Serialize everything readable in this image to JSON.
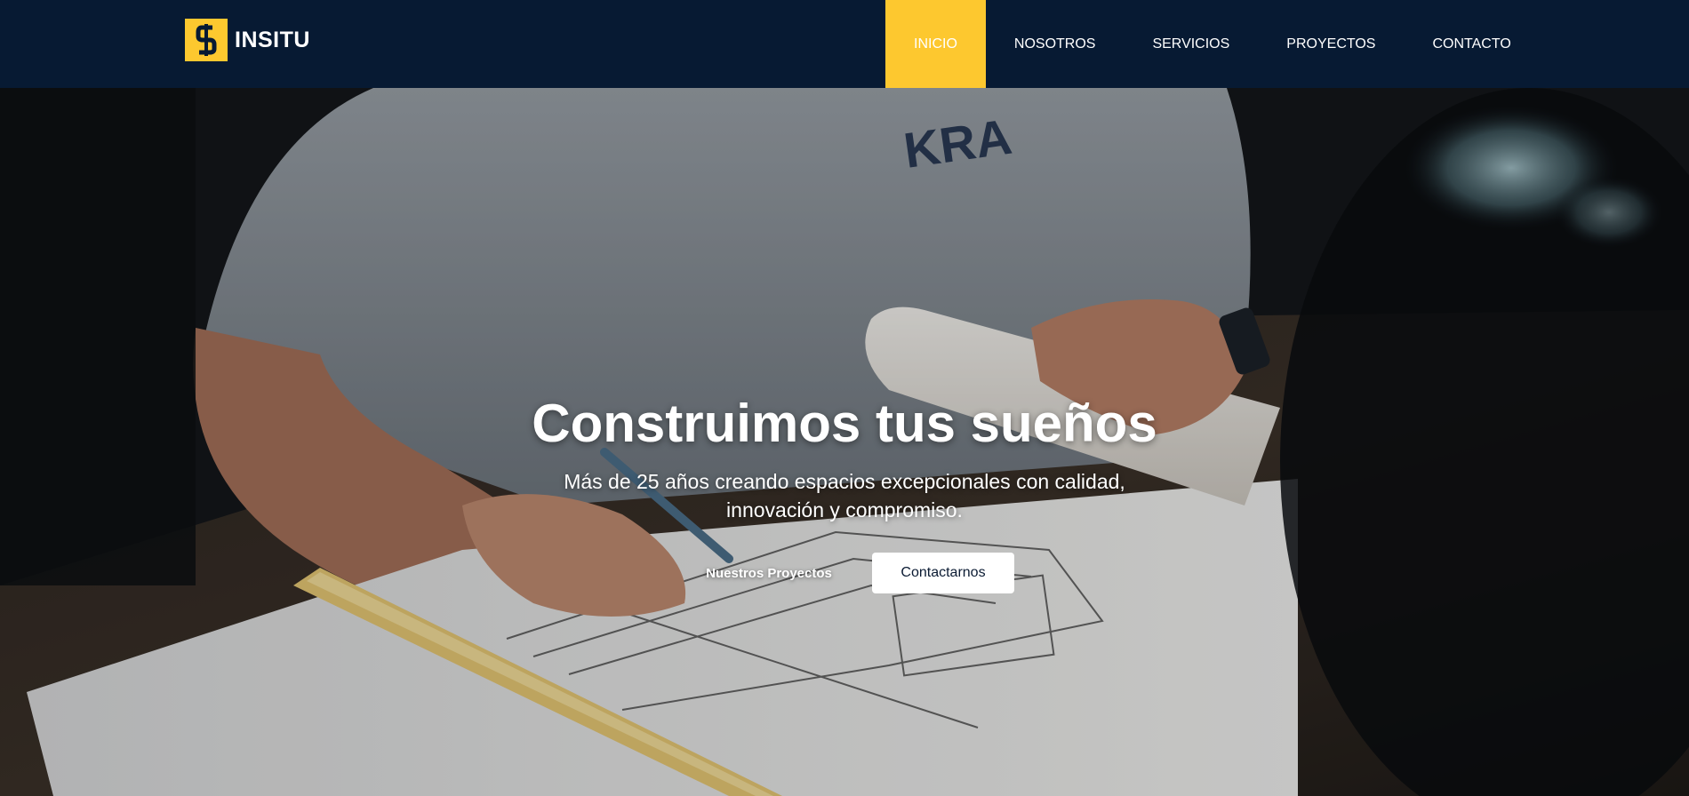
{
  "brand": {
    "logo_glyph": "S",
    "name": "INSITU",
    "accent_color": "#fdc82f",
    "header_color": "#071a33"
  },
  "nav": {
    "items": [
      {
        "label": "INICIO",
        "active": true
      },
      {
        "label": "NOSOTROS",
        "active": false
      },
      {
        "label": "SERVICIOS",
        "active": false
      },
      {
        "label": "PROYECTOS",
        "active": false
      },
      {
        "label": "CONTACTO",
        "active": false
      }
    ]
  },
  "hero": {
    "title": "Construimos tus sueños",
    "subtitle": "Más de 25 años creando espacios excepcionales con calidad, innovación y compromiso.",
    "secondary_button": "Nuestros Proyectos",
    "primary_button": "Contactarnos",
    "photo_shirt_text": "KRA"
  }
}
